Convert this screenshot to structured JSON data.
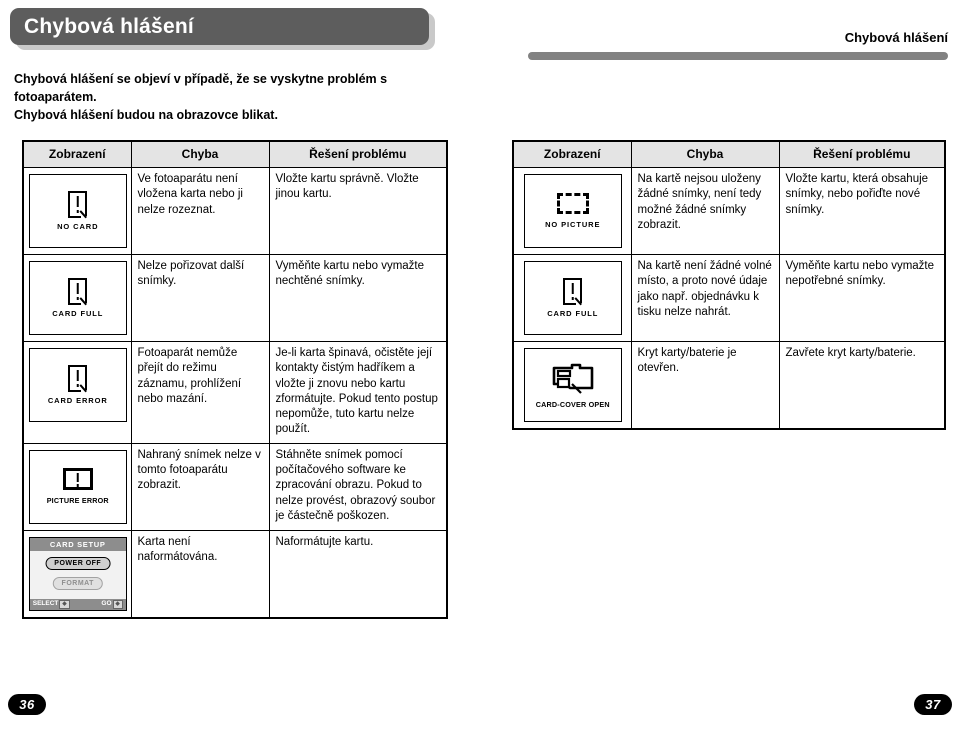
{
  "banner": {
    "title": "Chybová hlášení"
  },
  "running_head": "Chybová hlášení",
  "intro": {
    "line1": "Chybová hlášení se objeví v případě, že se vyskytne problém s fotoaparátem.",
    "line2": "Chybová hlášení budou na obrazovce blikat."
  },
  "table_headers": {
    "display": "Zobrazení",
    "error": "Chyba",
    "solution": "Řešení problému"
  },
  "left_table": {
    "rows": [
      {
        "icon": "card-exclamation-icon",
        "display_label": "NO  CARD",
        "error": "Ve fotoaparátu není vložena karta nebo ji nelze rozeznat.",
        "solution": "Vložte kartu správně. Vložte jinou kartu."
      },
      {
        "icon": "card-exclamation-icon",
        "display_label": "CARD  FULL",
        "error": "Nelze pořizovat další snímky.",
        "solution": "Vyměňte kartu nebo vymažte nechtěné snímky."
      },
      {
        "icon": "card-exclamation-icon",
        "display_label": "CARD  ERROR",
        "error": "Fotoaparát nemůže přejít do režimu záznamu, prohlížení nebo mazání.",
        "solution": "Je-li karta špinavá, očistěte její kontakty čistým hadříkem a vložte ji znovu nebo kartu zformátujte. Pokud tento postup nepomůže, tuto kartu nelze použít."
      },
      {
        "icon": "picture-exclamation-icon",
        "display_label": "PICTURE  ERROR",
        "error": "Nahraný snímek nelze v tomto fotoaparátu zobrazit.",
        "solution": "Stáhněte snímek pomocí počítačového software ke zpracování obrazu. Pokud to nelze provést, obrazový soubor je částečně poškozen."
      },
      {
        "icon": "card-setup-menu-icon",
        "menu": {
          "title": "CARD SETUP",
          "option_selected": "POWER OFF",
          "option_disabled": "FORMAT",
          "footer_left": "SELECT",
          "footer_right": "GO"
        },
        "error": "Karta není naformátována.",
        "solution": "Naformátujte kartu."
      }
    ]
  },
  "right_table": {
    "rows": [
      {
        "icon": "dashed-frame-icon",
        "display_label": "NO  PICTURE",
        "error": "Na kartě nejsou uloženy žádné snímky, není tedy možné žádné snímky zobrazit.",
        "solution": "Vložte kartu, která obsahuje snímky, nebo pořiďte nové snímky."
      },
      {
        "icon": "card-exclamation-icon",
        "display_label": "CARD  FULL",
        "error": "Na kartě není žádné volné místo, a proto nové údaje jako např. objednávku k tisku nelze nahrát.",
        "solution": "Vyměňte kartu nebo vymažte nepotřebné snímky."
      },
      {
        "icon": "camera-cover-open-icon",
        "display_label": "CARD-COVER OPEN",
        "error": "Kryt karty/baterie je otevřen.",
        "solution": "Zavřete kryt karty/baterie."
      }
    ]
  },
  "page_numbers": {
    "left": "36",
    "right": "37"
  },
  "colors": {
    "banner_bg": "#5d5d5d",
    "banner_shadow": "#c9c9c9",
    "rule": "#828282",
    "header_cell_bg": "#e4e4e4",
    "lcd_menu_bar": "#8d8d8d"
  }
}
